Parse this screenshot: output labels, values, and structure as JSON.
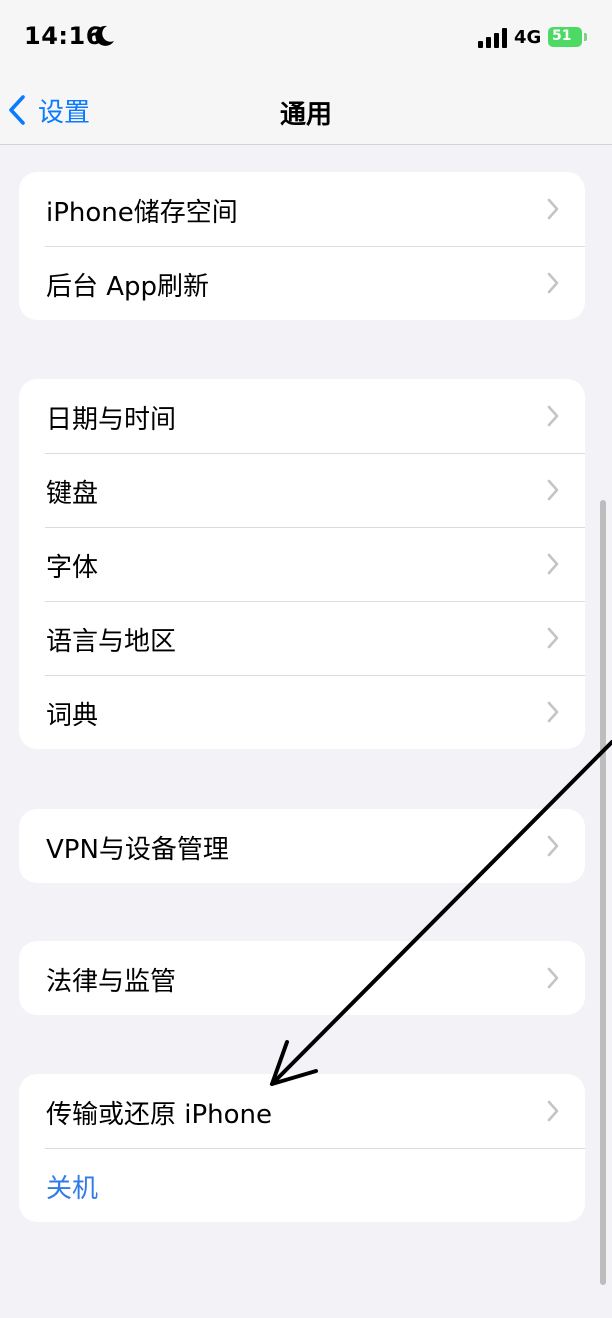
{
  "status_bar": {
    "time": "14:16",
    "network": "4G",
    "battery": "51",
    "icons": [
      "moon-icon",
      "signal-icon",
      "battery-icon"
    ]
  },
  "nav": {
    "back_label": "设置",
    "title": "通用"
  },
  "groups": [
    {
      "items": [
        {
          "label": "iPhone储存空间"
        },
        {
          "label": "后台 App刷新"
        }
      ]
    },
    {
      "items": [
        {
          "label": "日期与时间"
        },
        {
          "label": "键盘"
        },
        {
          "label": "字体"
        },
        {
          "label": "语言与地区"
        },
        {
          "label": "词典"
        }
      ]
    },
    {
      "items": [
        {
          "label": "VPN与设备管理"
        }
      ]
    },
    {
      "items": [
        {
          "label": "法律与监管"
        }
      ]
    },
    {
      "items": [
        {
          "label": "传输或还原 iPhone"
        },
        {
          "label": "关机"
        }
      ]
    }
  ],
  "colors": {
    "accent": "#0a7aff",
    "background": "#f2f2f7",
    "battery": "#4cd964",
    "shutdown": "#2f7ce8"
  }
}
